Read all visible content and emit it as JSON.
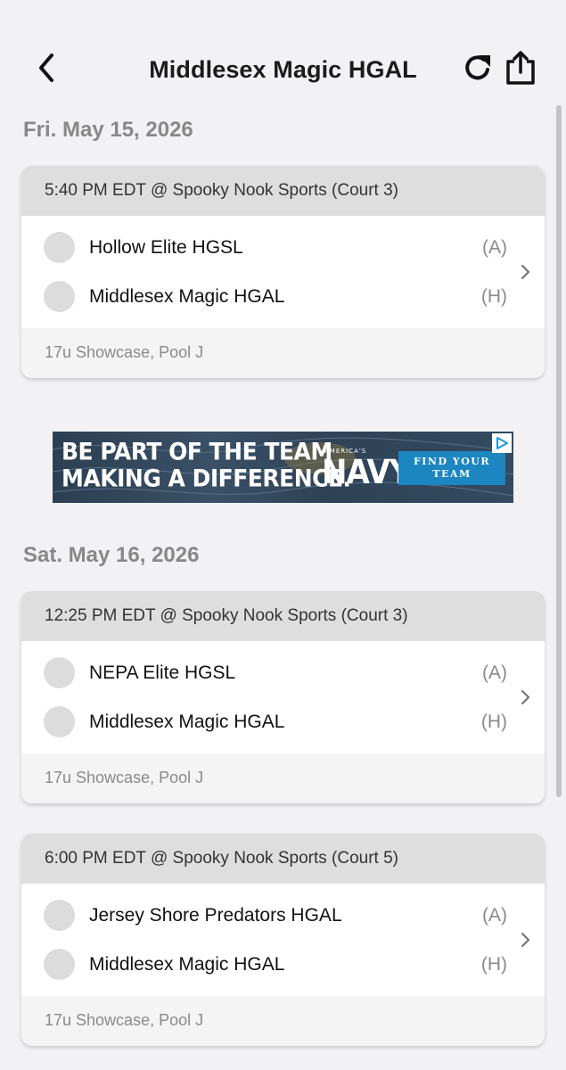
{
  "header": {
    "title": "Middlesex Magic HGAL",
    "back_icon": "chevron-left-icon",
    "refresh_icon": "refresh-icon",
    "share_icon": "share-icon"
  },
  "days": [
    {
      "date": "Fri. May 15, 2026",
      "games": [
        {
          "time_venue": "5:40 PM EDT @ Spooky Nook Sports (Court 3)",
          "away": {
            "name": "Hollow Elite HGSL",
            "side": "(A)"
          },
          "home": {
            "name": "Middlesex Magic HGAL",
            "side": "(H)"
          },
          "event": "17u Showcase, Pool J"
        }
      ]
    },
    {
      "date": "Sat. May 16, 2026",
      "games": [
        {
          "time_venue": "12:25 PM EDT @ Spooky Nook Sports (Court 3)",
          "away": {
            "name": "NEPA Elite HGSL",
            "side": "(A)"
          },
          "home": {
            "name": "Middlesex Magic HGAL",
            "side": "(H)"
          },
          "event": "17u Showcase, Pool J"
        },
        {
          "time_venue": "6:00 PM EDT @ Spooky Nook Sports (Court 5)",
          "away": {
            "name": "Jersey Shore Predators HGAL",
            "side": "(A)"
          },
          "home": {
            "name": "Middlesex Magic HGAL",
            "side": "(H)"
          },
          "event": "17u Showcase, Pool J"
        }
      ]
    }
  ],
  "ad": {
    "line1": "BE PART OF THE TEAM",
    "line2": "MAKING A DIFFERENCE.",
    "brand_small": "AMERICA'S",
    "brand": "NAVY",
    "cta": "FIND YOUR TEAM",
    "choices_icon": "ad-choices-icon"
  },
  "colors": {
    "background": "#f2f2f4",
    "card_header": "#dedede",
    "muted_text": "#8a8a8a",
    "ad_cta": "#1b86c0"
  }
}
